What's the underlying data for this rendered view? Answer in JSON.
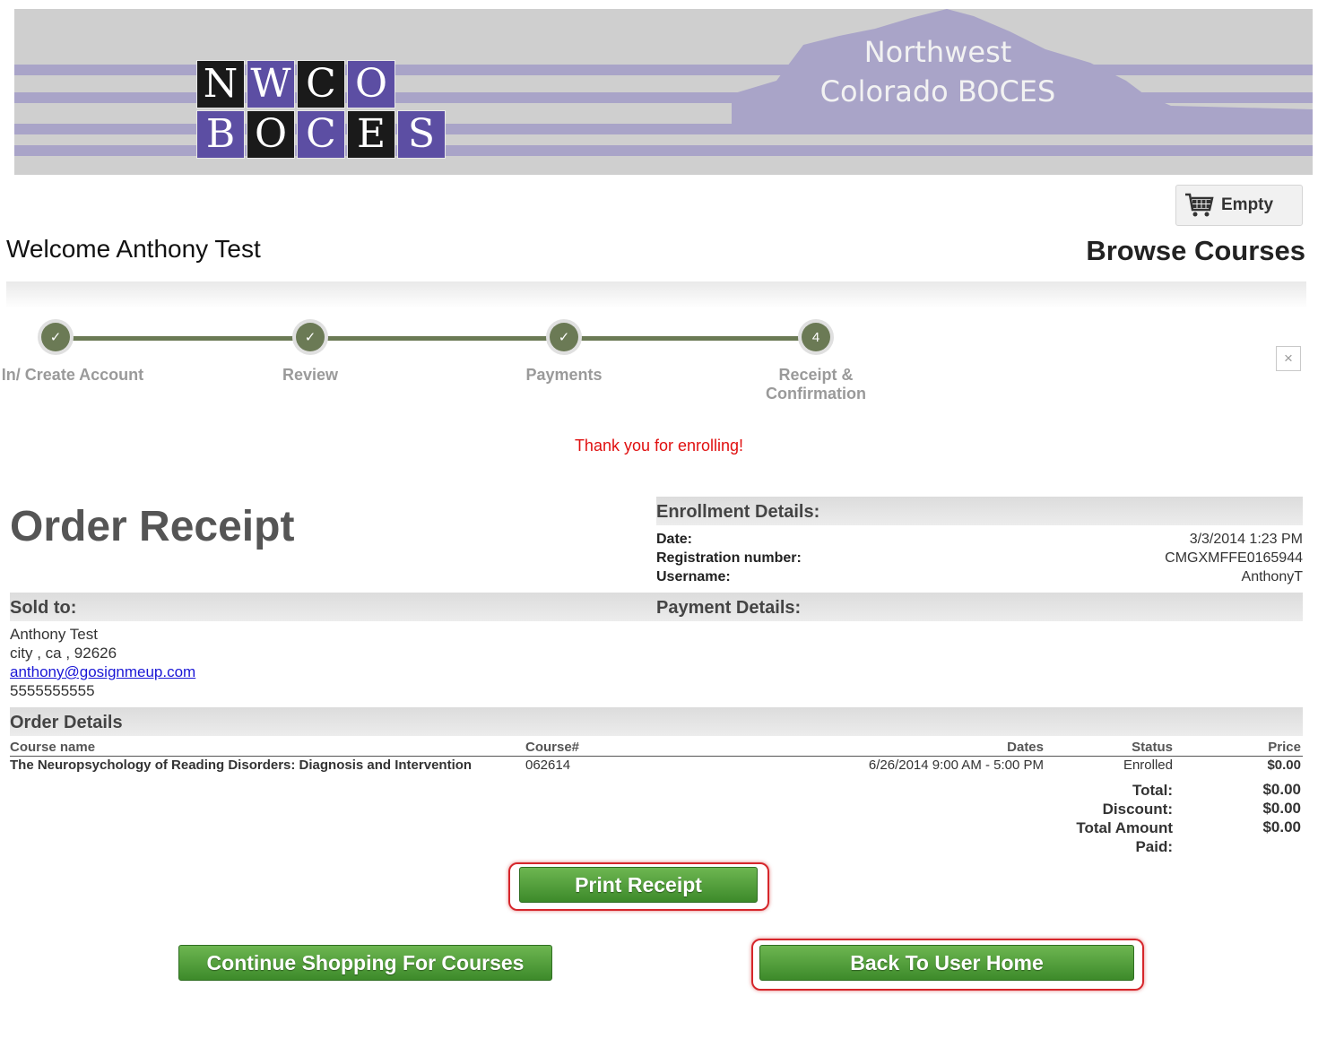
{
  "header": {
    "logo_letters": [
      [
        "N",
        "W",
        "C",
        "O"
      ],
      [
        "B",
        "O",
        "C",
        "E",
        "S"
      ]
    ],
    "org_name_line1": "Northwest",
    "org_name_line2": "Colorado BOCES"
  },
  "cart": {
    "icon": "cart-icon",
    "label": "Empty"
  },
  "welcome_text": "Welcome Anthony Test",
  "browse_link": "Browse Courses",
  "steps": [
    {
      "marker": "✓",
      "label": "Log In/ Create Account"
    },
    {
      "marker": "✓",
      "label": "Review"
    },
    {
      "marker": "✓",
      "label": "Payments"
    },
    {
      "marker": "4",
      "label": "Receipt & Confirmation"
    }
  ],
  "close_glyph": "×",
  "thanks_message": "Thank you for enrolling!",
  "order_title": "Order Receipt",
  "enrollment": {
    "heading": "Enrollment Details:",
    "date_label": "Date:",
    "date_value": "3/3/2014 1:23 PM",
    "reg_label": "Registration number:",
    "reg_value": "CMGXMFFE0165944",
    "user_label": "Username:",
    "user_value": "AnthonyT"
  },
  "sold_to": {
    "heading": "Sold to:",
    "name": "Anthony Test",
    "address": "city , ca , 92626",
    "email": "anthony@gosignmeup.com",
    "phone": "5555555555"
  },
  "payment_heading": "Payment Details:",
  "order_details": {
    "heading": "Order Details",
    "columns": {
      "course_name": "Course name",
      "course_num": "Course#",
      "dates": "Dates",
      "status": "Status",
      "price": "Price"
    },
    "rows": [
      {
        "course_name": "The Neuropsychology of Reading Disorders: Diagnosis and Intervention",
        "course_num": "062614",
        "dates": "6/26/2014 9:00 AM - 5:00 PM",
        "status": "Enrolled",
        "price": "$0.00"
      }
    ],
    "totals": {
      "total_label": "Total:",
      "total_value": "$0.00",
      "discount_label": "Discount:",
      "discount_value": "$0.00",
      "paid_label_1": "Total Amount",
      "paid_label_2": "Paid:",
      "paid_value": "$0.00"
    }
  },
  "buttons": {
    "print": "Print Receipt",
    "continue": "Continue Shopping For Courses",
    "home": "Back To User Home"
  }
}
